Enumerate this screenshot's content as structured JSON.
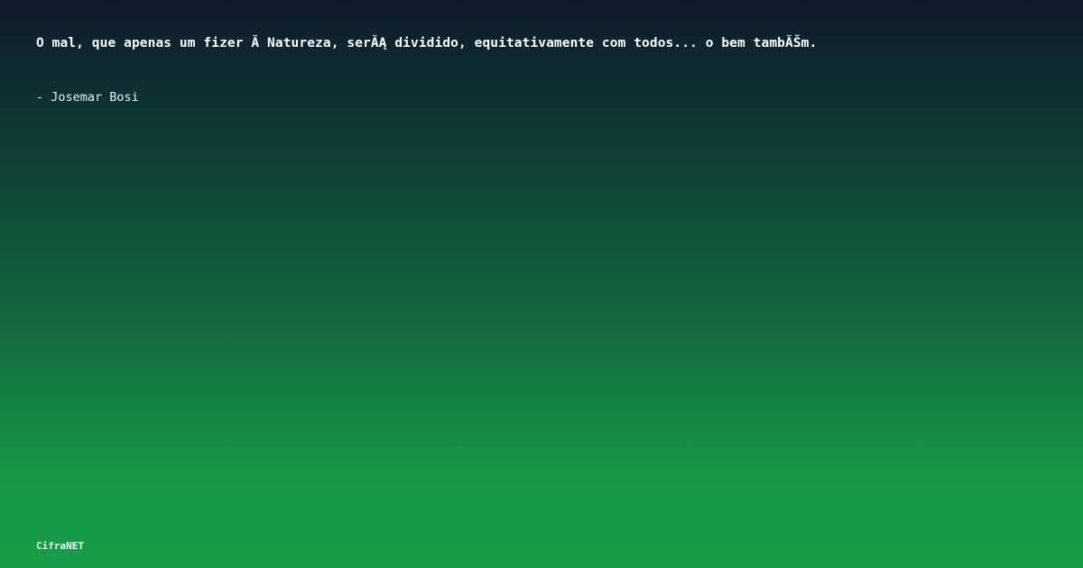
{
  "quote": {
    "text": "O mal, que apenas um fizer Ă  Natureza, serĂĄ dividido, equitativamente com todos... o bem tambĂŠm."
  },
  "author": {
    "text": "- Josemar Bosi"
  },
  "brand": {
    "name": "CifraNET"
  }
}
